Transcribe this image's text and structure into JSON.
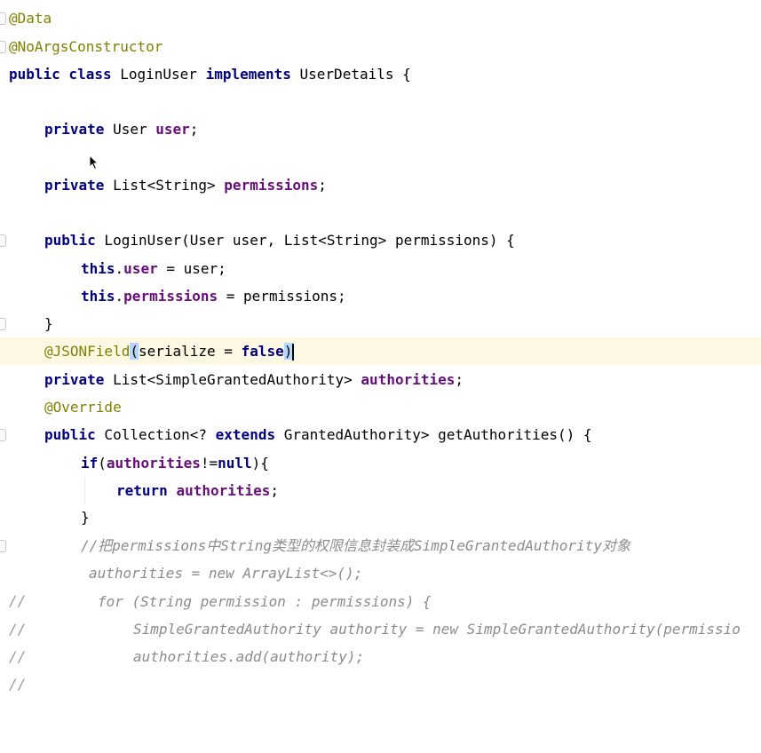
{
  "lines": {
    "l1": {
      "ann": "@Data"
    },
    "l2": {
      "ann": "@NoArgsConstructor"
    },
    "l3": {
      "kw1": "public class",
      "name": " LoginUser ",
      "kw2": "implements",
      "rest": " UserDetails {"
    },
    "l5": {
      "kw": "private",
      "type": " User ",
      "field": "user",
      "end": ";"
    },
    "l7": {
      "kw": "private",
      "type": " List<String> ",
      "field": "permissions",
      "end": ";"
    },
    "l9": {
      "kw": "public",
      "rest": " LoginUser(User user, List<String> permissions) {"
    },
    "l10": {
      "kw": "this",
      "dot": ".",
      "field": "user",
      "rest": " = user;"
    },
    "l11": {
      "kw": "this",
      "dot": ".",
      "field": "permissions",
      "rest": " = permissions;"
    },
    "l12": {
      "brace": "}"
    },
    "l13": {
      "ann": "@JSONField",
      "open": "(",
      "mid": "serialize = ",
      "kw": "false",
      "close": ")"
    },
    "l14": {
      "kw": "private",
      "type": " List<SimpleGrantedAuthority> ",
      "field": "authorities",
      "end": ";"
    },
    "l15": {
      "ann": "@Override"
    },
    "l16": {
      "kw1": "public",
      "a": " Collection<? ",
      "kw2": "extends",
      "b": " GrantedAuthority> getAuthorities() {"
    },
    "l17": {
      "kw": "if",
      "a": "(",
      "field": "authorities",
      "b": "!=",
      "kw2": "null",
      "c": "){"
    },
    "l18": {
      "kw": "return",
      "sp": " ",
      "field": "authorities",
      "end": ";"
    },
    "l19": {
      "brace": "}"
    },
    "l20": {
      "cmt": "//把permissions中String类型的权限信息封装成SimpleGrantedAuthority对象"
    },
    "l21": {
      "slash": "//",
      "cmt": "authorities = new ArrayList<>();"
    },
    "l22": {
      "slash": "//",
      "cmt": "for (String permission : permissions) {"
    },
    "l23": {
      "slash": "//",
      "cmt": "SimpleGrantedAuthority authority = new SimpleGrantedAuthority(permissio"
    },
    "l24": {
      "slash": "//",
      "cmt": "authorities.add(authority);"
    }
  }
}
